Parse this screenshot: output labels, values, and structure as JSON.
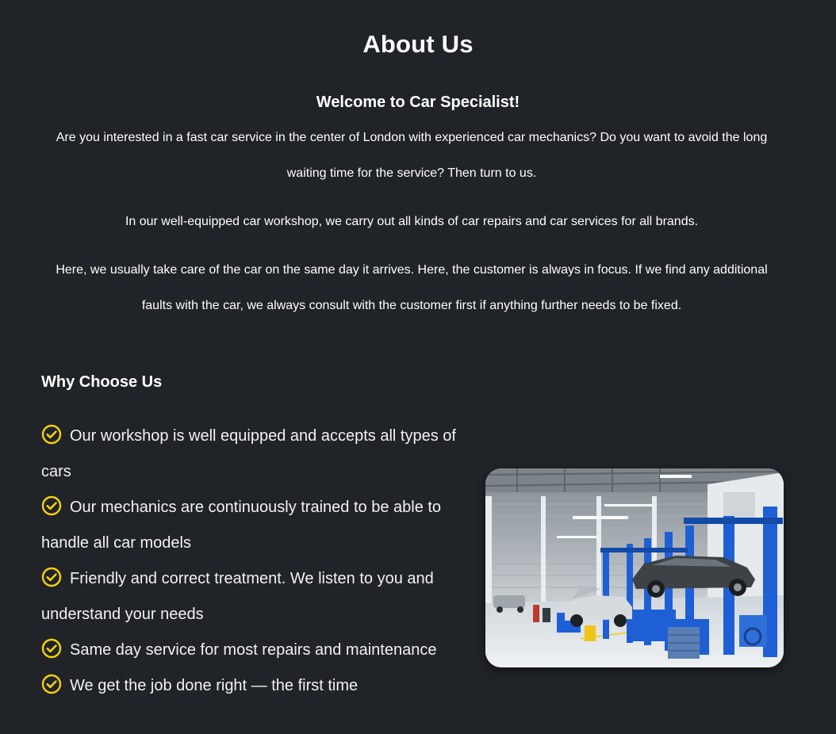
{
  "about": {
    "title": "About Us",
    "welcome": "Welcome to Car Specialist!",
    "paragraphs": [
      "Are you interested in a fast car service in the center of London with experienced car mechanics? Do you want to avoid the long waiting time for the service? Then turn to us.",
      "In our well-equipped car workshop, we carry out all kinds of car repairs and car services for all brands.",
      "Here, we usually take care of the car on the same day it arrives. Here, the customer is always in focus. If we find any additional faults with the car, we always consult with the customer first if anything further needs to be fixed."
    ]
  },
  "why": {
    "title": "Why Choose Us",
    "icon": "check-circle-icon",
    "icon_color": "#f5d20a",
    "items": [
      "Our workshop is well equipped and accepts all types of cars",
      "Our mechanics are continuously trained to be able to handle all car models",
      "Friendly and correct treatment. We listen to you and understand your needs",
      "Same day service for most repairs and maintenance",
      "We get the job done right — the first time"
    ]
  },
  "image": {
    "subject": "car-workshop-photo"
  },
  "colors": {
    "background": "#202327",
    "text": "#ffffff",
    "accent": "#f5d20a",
    "lift_blue": "#1f5fd6"
  }
}
